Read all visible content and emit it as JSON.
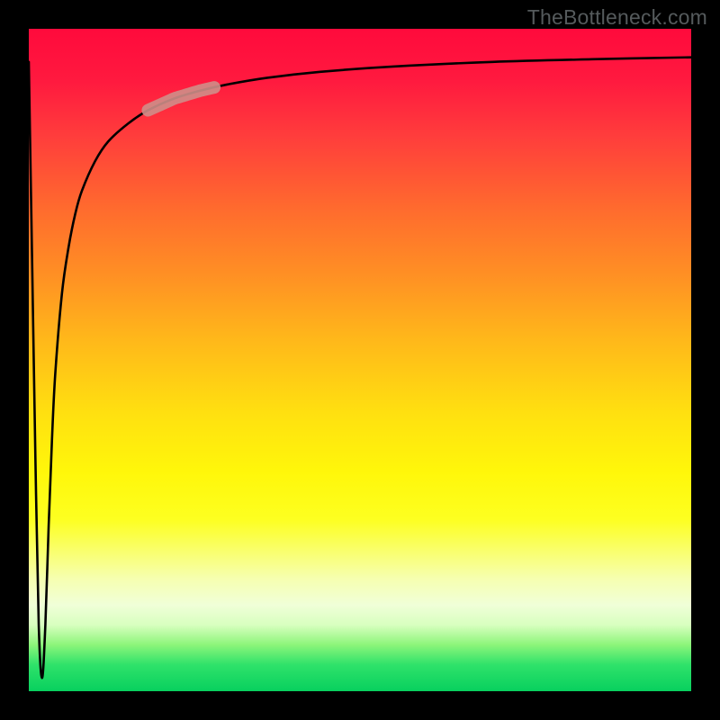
{
  "attribution": "TheBottleneck.com",
  "chart_data": {
    "type": "line",
    "title": "",
    "xlabel": "",
    "ylabel": "",
    "xlim": [
      0,
      100
    ],
    "ylim": [
      0,
      100
    ],
    "series": [
      {
        "name": "curve",
        "x": [
          0.0,
          0.5,
          1.0,
          1.5,
          2.0,
          2.5,
          3.0,
          3.5,
          4.0,
          5.0,
          6.0,
          7.0,
          8.0,
          10.0,
          12.0,
          15.0,
          18.0,
          22.0,
          26.0,
          30.0,
          36.0,
          44.0,
          55.0,
          70.0,
          85.0,
          100.0
        ],
        "y": [
          95.0,
          65.0,
          35.0,
          10.0,
          2.0,
          10.0,
          25.0,
          38.0,
          48.0,
          60.0,
          67.0,
          72.0,
          75.5,
          80.0,
          83.0,
          85.7,
          87.7,
          89.5,
          90.7,
          91.6,
          92.6,
          93.5,
          94.3,
          95.0,
          95.4,
          95.7
        ]
      }
    ],
    "highlight_segment": {
      "x_start": 18.0,
      "x_end": 28.0
    }
  },
  "colors": {
    "curve_stroke": "#000000",
    "highlight_stroke": "#cf8e88"
  }
}
